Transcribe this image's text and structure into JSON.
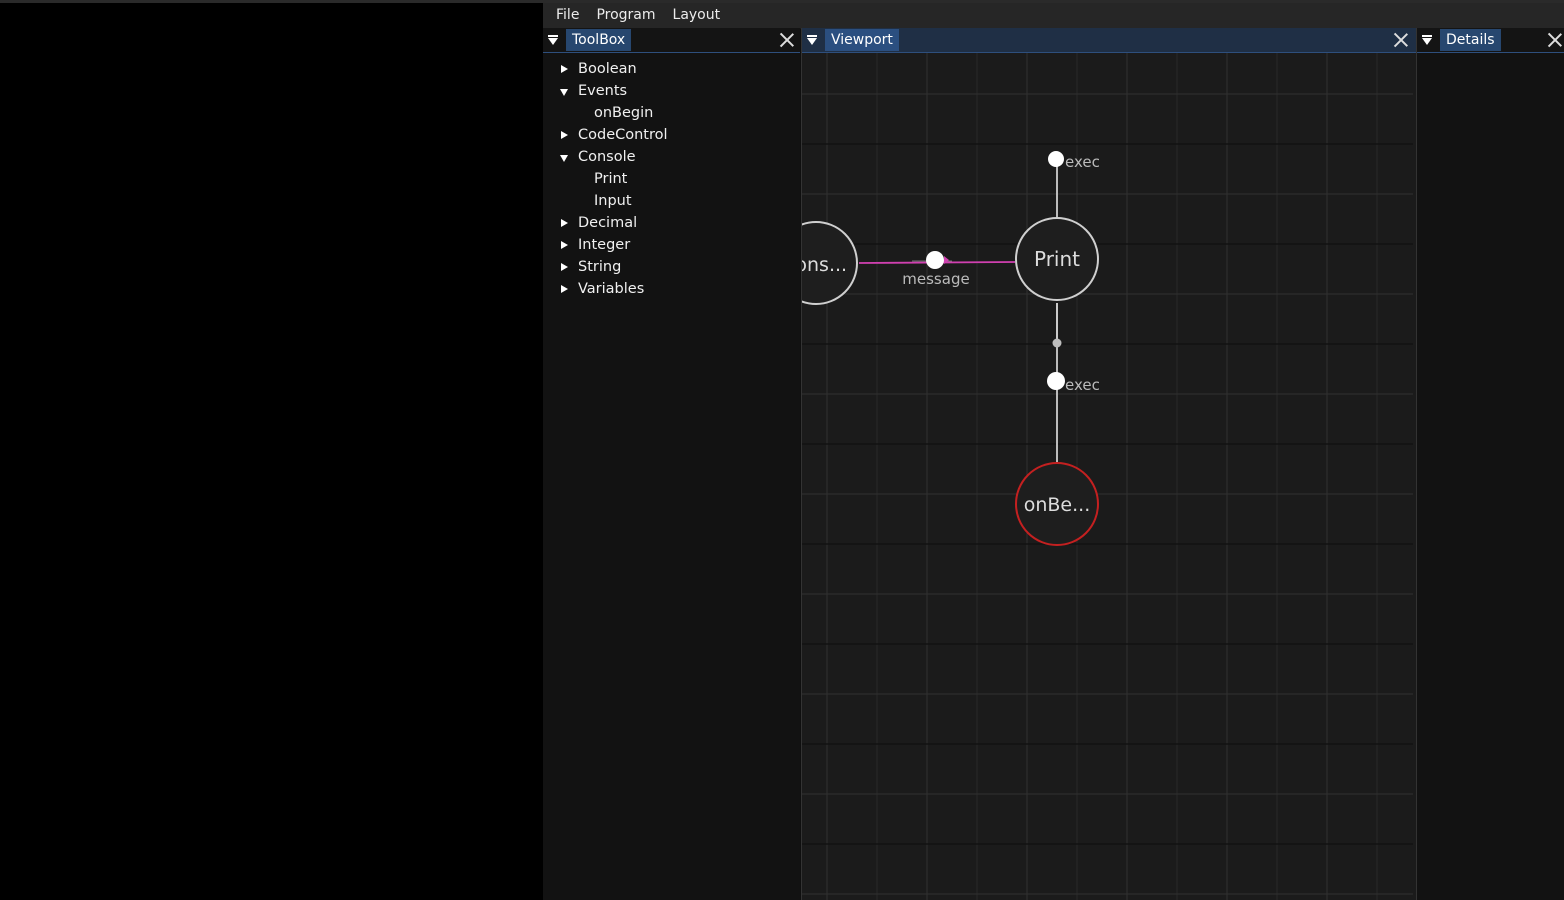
{
  "menubar": {
    "items": [
      "File",
      "Program",
      "Layout"
    ]
  },
  "panels": {
    "toolbox": {
      "title": "ToolBox"
    },
    "viewport": {
      "title": "Viewport"
    },
    "details": {
      "title": "Details"
    }
  },
  "toolbox_tree": [
    {
      "label": "Boolean",
      "expanded": false,
      "children": []
    },
    {
      "label": "Events",
      "expanded": true,
      "children": [
        "onBegin"
      ]
    },
    {
      "label": "CodeControl",
      "expanded": false,
      "children": []
    },
    {
      "label": "Console",
      "expanded": true,
      "children": [
        "Print",
        "Input"
      ]
    },
    {
      "label": "Decimal",
      "expanded": false,
      "children": []
    },
    {
      "label": "Integer",
      "expanded": false,
      "children": []
    },
    {
      "label": "String",
      "expanded": false,
      "children": []
    },
    {
      "label": "Variables",
      "expanded": false,
      "children": []
    }
  ],
  "graph": {
    "nodes": {
      "const": {
        "label": "cons..."
      },
      "print": {
        "label": "Print"
      },
      "onbegin": {
        "label": "onBe..."
      }
    },
    "pins": {
      "print_exec_in": "exec",
      "message": "message",
      "onbegin_exec_out": "exec"
    },
    "colors": {
      "node_fill": "#1e1e1e",
      "node_border": "#cfcfcf",
      "event_border": "#c42020",
      "data_link": "#d040b0",
      "exec_link": "#cfcfcf",
      "grid_minor": "#303030",
      "grid_major": "#121212"
    }
  }
}
